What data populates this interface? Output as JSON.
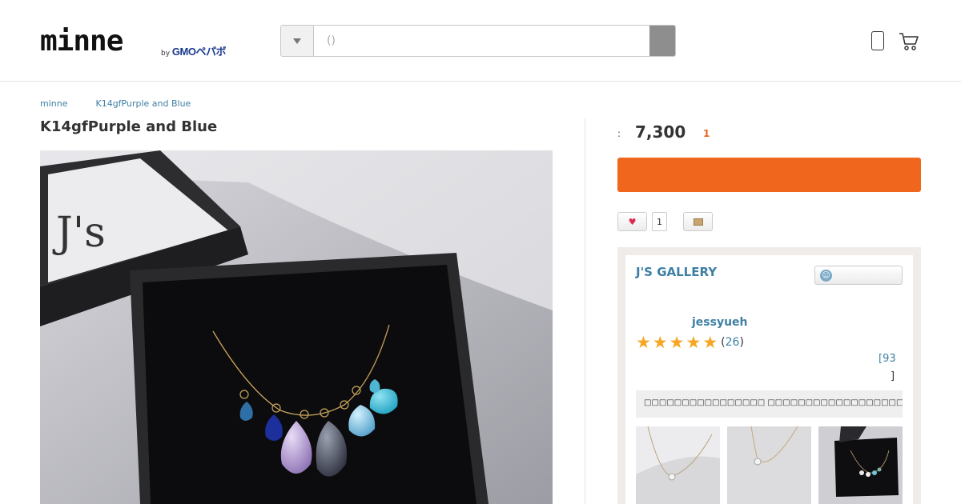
{
  "header": {
    "logo_text": "minne",
    "logo_by": "by",
    "logo_company": "GMOペパボ",
    "search_placeholder": "()"
  },
  "breadcrumb": [
    "minne",
    "K14gfPurple and Blue"
  ],
  "product": {
    "title": "K14gfPurple and Blue",
    "price_label": ":",
    "price": "7,300",
    "stock": "1"
  },
  "actions": {
    "favorite_count": "1"
  },
  "shop": {
    "name": "J'S GALLERY",
    "owner": "jessyueh",
    "review_count_open": "(",
    "review_count": "26",
    "review_count_close": ")",
    "rating": 5,
    "items_count_prefix": "[93",
    "items_count_suffix": "]",
    "description": "□□□□□□□□□□□□□□□□ □□□□□□□□□□□□□□□□□□□□↗□"
  },
  "colors": {
    "accent": "#f0661d",
    "link": "#3e7fa3",
    "stock": "#e8641e",
    "star": "#f5a623"
  },
  "icons": [
    "phone-icon",
    "cart-icon",
    "heart-icon",
    "envelope-icon",
    "smile-icon",
    "star-icon",
    "dropdown-triangle-icon"
  ]
}
